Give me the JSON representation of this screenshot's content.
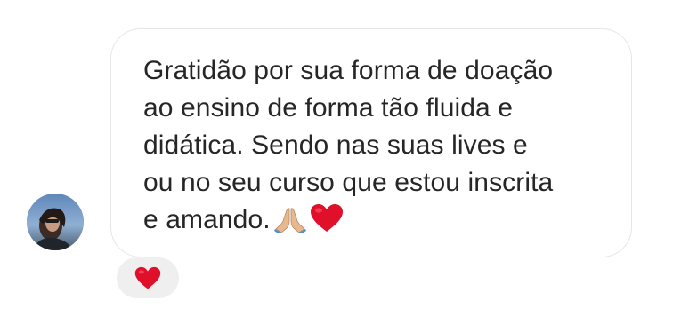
{
  "message": {
    "lines": [
      "Gratidão por sua forma de doação",
      "ao ensino de forma tão fluida e",
      "didática. Sendo nas suas lives e",
      "ou no seu curso que estou inscrita",
      "e amando."
    ],
    "trailing_emojis": [
      "folded-hands-icon",
      "red-heart-icon"
    ]
  },
  "sender": {
    "avatar_icon": "profile-photo"
  },
  "reaction": {
    "icon": "red-heart-icon",
    "color": "#e0102a"
  },
  "colors": {
    "text": "#262626",
    "bubble_border": "#e6e6e6",
    "reaction_bg": "#efefef"
  }
}
